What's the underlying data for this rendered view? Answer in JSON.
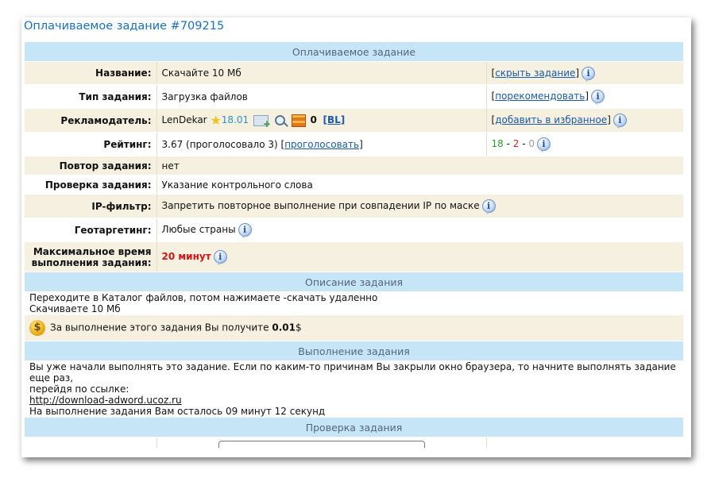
{
  "page": {
    "title": "Оплачиваемое задание #709215"
  },
  "sections": {
    "paid_task": "Оплачиваемое задание",
    "description": "Описание задания",
    "execution": "Выполнение задания",
    "check": "Проверка задания"
  },
  "rows": {
    "name": {
      "label": "Название:",
      "value": "Скачайте 10 Мб",
      "action_pre": "[",
      "action_link": "скрыть задание",
      "action_post": "]"
    },
    "type": {
      "label": "Тип задания:",
      "value": "Загрузка файлов",
      "action_pre": "[",
      "action_link": "порекомендовать",
      "action_post": "]"
    },
    "advertiser": {
      "label": "Рекламодатель:",
      "name": "LenDekar",
      "rating": "18.01",
      "count": "0",
      "bl": "[BL]",
      "action_pre": "[",
      "action_link": "добавить в избранное",
      "action_post": "]"
    },
    "rating": {
      "label": "Рейтинг:",
      "value": "3.67 (проголосовало 3) [",
      "vote_link": "проголосовать",
      "vote_post": "]",
      "pos": "18",
      "sep1": " - ",
      "neg": "2",
      "sep2": " - ",
      "neutral": "0"
    },
    "repeat": {
      "label": "Повтор задания:",
      "value": "нет"
    },
    "verification": {
      "label": "Проверка задания:",
      "value": "Указание контрольного слова"
    },
    "ip": {
      "label": "IP-фильтр:",
      "value": "Запретить повторное выполнение при совпадении IP по маске"
    },
    "geo": {
      "label": "Геотаргетинг:",
      "value": "Любые страны"
    },
    "maxtime": {
      "label_line1": "Максимальное время",
      "label_line2": "выполнения задания:",
      "value": "20 минут"
    }
  },
  "description": {
    "line1": "Переходите в Каталог файлов, потом нажимаете -скачать удаленно",
    "line2": "Скачиваете 10 Мб"
  },
  "reward": {
    "text": "За выполнение этого задания Вы получите",
    "amount": "0.01",
    "currency": "$"
  },
  "execution": {
    "line1": "Вы уже начали выполнять это задание. Если по каким-то причинам Вы закрыли окно браузера, то начните выполнять задание еще раз,",
    "line2": "перейдя по ссылке:",
    "link": "http://download-adword.ucoz.ru",
    "line3": "На выполнение задания Вам осталось 09 минут 12 секунд"
  },
  "icons": {
    "info": "info-bubble-icon",
    "star": "star-icon",
    "mail": "mail-add-icon",
    "search": "magnifier-icon",
    "box": "brick-box-icon",
    "coin": "dollar-coin-icon"
  },
  "colors": {
    "header_bg": "#c6e6f8",
    "stripe_bg": "#f5f0e0",
    "title": "#1a6fc4",
    "time_red": "#d41414"
  }
}
